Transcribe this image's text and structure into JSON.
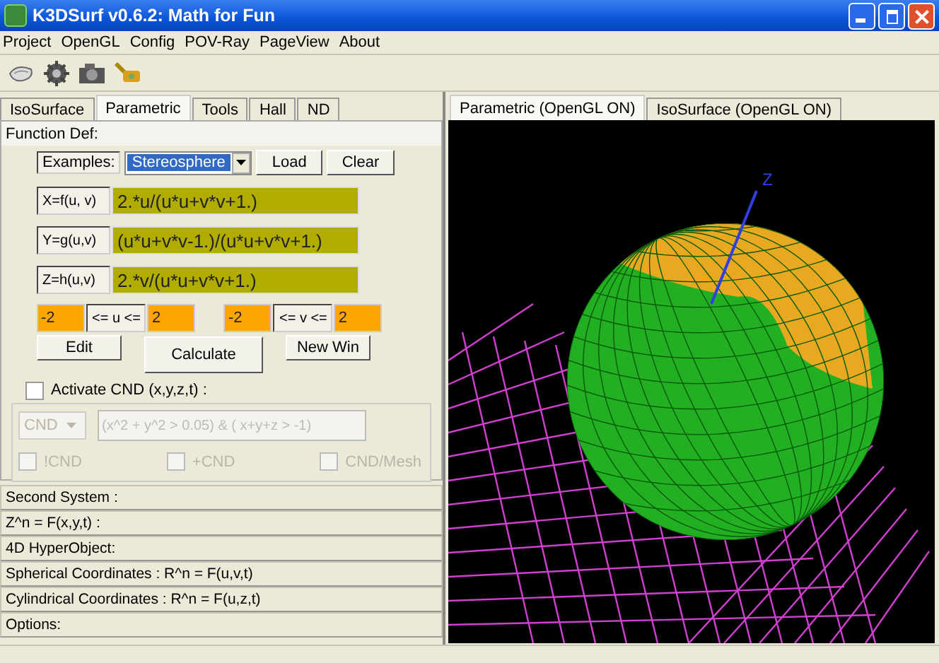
{
  "window": {
    "title": "K3DSurf v0.6.2: Math for Fun"
  },
  "menu": [
    "Project",
    "OpenGL",
    "Config",
    "POV-Ray",
    "PageView",
    "About"
  ],
  "left_tabs": [
    {
      "label": "IsoSurface",
      "selected": false
    },
    {
      "label": "Parametric",
      "selected": true
    },
    {
      "label": "Tools",
      "selected": false
    },
    {
      "label": "Hall",
      "selected": false
    },
    {
      "label": "ND",
      "selected": false
    }
  ],
  "function_def": {
    "title": "Function Def:",
    "examples_label": "Examples:",
    "examples_value": "Stereosphere",
    "buttons": [
      "Load",
      "Clear"
    ],
    "equations": [
      {
        "label": "X=f(u, v)",
        "value": "2.*u/(u*u+v*v+1.)"
      },
      {
        "label": "Y=g(u,v)",
        "value": "(u*u+v*v-1.)/(u*u+v*v+1.)"
      },
      {
        "label": "Z=h(u,v)",
        "value": "2.*v/(u*u+v*v+1.)"
      }
    ],
    "ranges": [
      {
        "min": "-2",
        "label": "<= u <=",
        "max": "2"
      },
      {
        "min": "-2",
        "label": "<= v <=",
        "max": "2"
      }
    ],
    "actions": [
      "Edit",
      "Calculate",
      "New Win"
    ]
  },
  "cnd": {
    "label": "Activate CND (x,y,z,t) :",
    "checked": false,
    "disabled": true,
    "mode": "CND",
    "condition": "(x^2 + y^2 > 0.05) & ( x+y+z > -1)",
    "options": [
      {
        "label": "!CND",
        "checked": false
      },
      {
        "label": "+CND",
        "checked": false
      },
      {
        "label": "CND/Mesh",
        "checked": false
      }
    ]
  },
  "sections": [
    "Second System :",
    "Z^n = F(x,y,t) :",
    "4D HyperObject:",
    "Spherical Coordinates : R^n = F(u,v,t)",
    "Cylindrical Coordinates : R^n = F(u,z,t)",
    "Options:"
  ],
  "view_tabs": [
    {
      "label": "Parametric (OpenGL ON)",
      "selected": true
    },
    {
      "label": "IsoSurface (OpenGL ON)",
      "selected": false
    }
  ],
  "viewport": {
    "axis_label": "Z"
  }
}
